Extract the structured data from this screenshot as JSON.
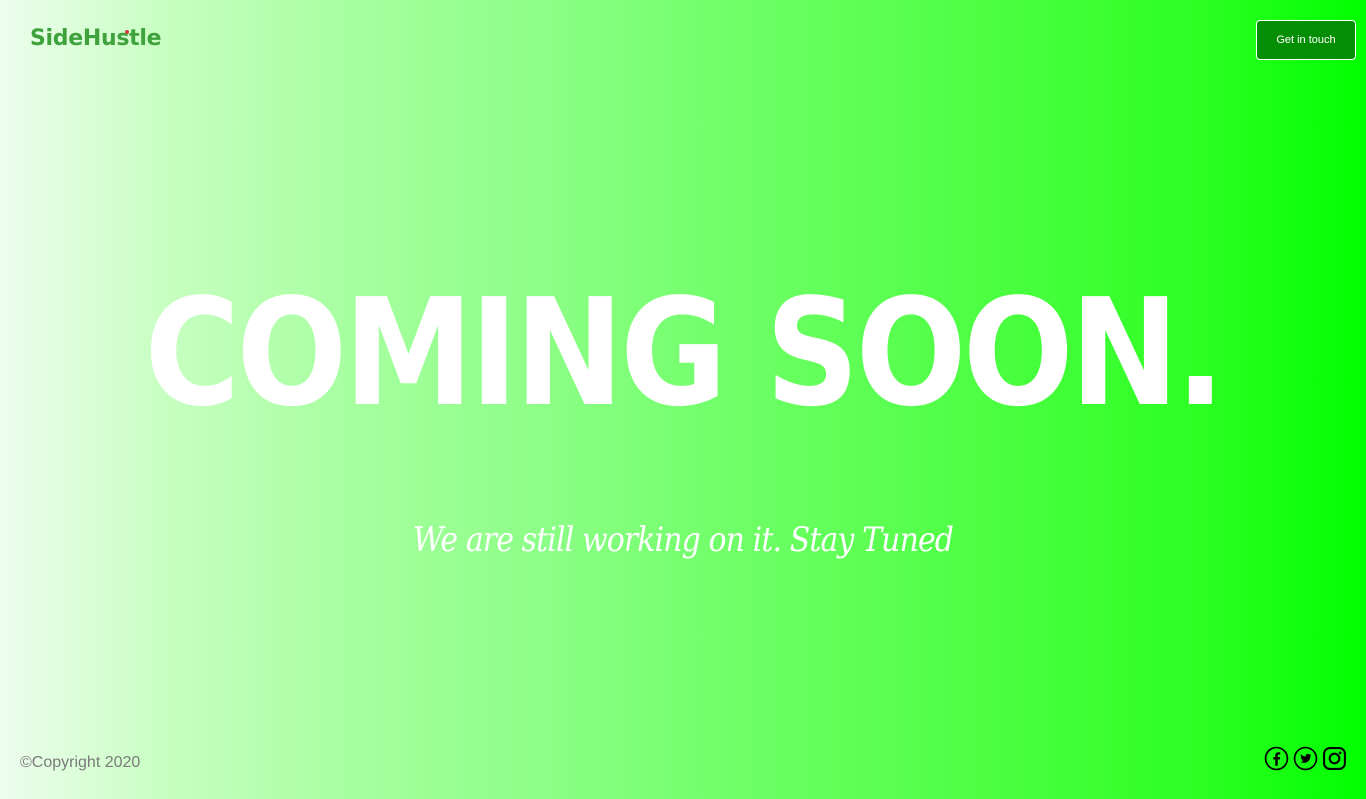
{
  "header": {
    "logo_text": "SideHustle",
    "cta_label": "Get in touch"
  },
  "hero": {
    "headline": "COMING SOON.",
    "tagline": "We are still working on it. Stay Tuned"
  },
  "footer": {
    "copyright": "©Copyright 2020",
    "social": [
      {
        "name": "facebook-icon"
      },
      {
        "name": "twitter-icon"
      },
      {
        "name": "instagram-icon"
      }
    ]
  },
  "colors": {
    "logo": "#3fa23c",
    "cta_background": "#048e04",
    "gradient_start": "#eefdee",
    "gradient_end": "#00ff00",
    "text_white": "#ffffff",
    "copyright_text": "#7a7a7a"
  }
}
